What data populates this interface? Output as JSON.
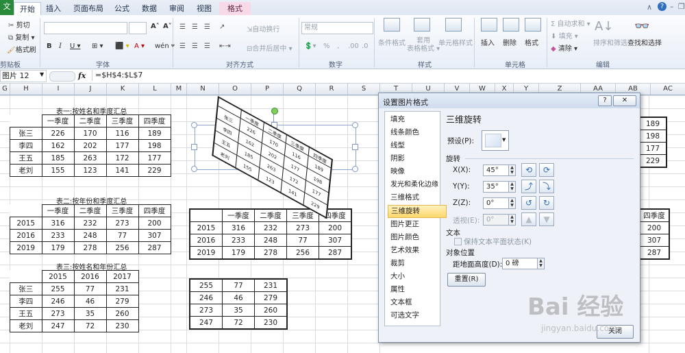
{
  "ribbon": {
    "file_tab": "文件",
    "tabs": [
      "开始",
      "插入",
      "页面布局",
      "公式",
      "数据",
      "审阅",
      "视图",
      "格式"
    ],
    "clipboard": {
      "cut": "剪切",
      "copy": "复制 ▾",
      "format_painter": "格式刷",
      "label": "剪贴板"
    },
    "font": {
      "label": "字体",
      "grow": "A˄",
      "shrink": "A˅",
      "bold": "B",
      "italic": "I",
      "underline": "U ▾",
      "border": "⊞ ▾",
      "fill_color": "⬛ ▾",
      "font_color": "A ▾",
      "wen": "wén ▾"
    },
    "alignment": {
      "wrap": "自动换行",
      "merge": "合并后居中 ▾",
      "label": "对齐方式"
    },
    "number": {
      "format_value": "常规",
      "percent": "%",
      "comma": ",",
      "label": "数字"
    },
    "styles": {
      "conditional": "条件格式",
      "table": "套用\n表格格式 ▾",
      "cell_styles": "单元格样式",
      "label": "样式"
    },
    "cells": {
      "insert": "插入",
      "delete": "删除",
      "format": "格式",
      "label": "单元格"
    },
    "editing": {
      "autosum": "Σ 自动求和 ▾",
      "fill": "填充 ▾",
      "clear": "清除 ▾",
      "sort": "排序和筛选",
      "find": "查找和选择",
      "label": "编辑"
    }
  },
  "formula_bar": {
    "name_box": "图片 12",
    "fx": "fx",
    "formula": "=$H$4:$L$7"
  },
  "columns": [
    "G",
    "H",
    "I",
    "J",
    "K",
    "L",
    "M",
    "N",
    "O",
    "P",
    "Q",
    "R",
    "S",
    "T",
    "U",
    "V",
    "W",
    "X",
    "Y",
    "Z",
    "AA",
    "AB",
    "AC"
  ],
  "table1": {
    "title": "表一:按姓名和季度汇总",
    "header": [
      "",
      "一季度",
      "二季度",
      "三季度",
      "四季度"
    ],
    "rows": [
      [
        "张三",
        "226",
        "170",
        "116",
        "189"
      ],
      [
        "李四",
        "162",
        "202",
        "177",
        "198"
      ],
      [
        "王五",
        "185",
        "263",
        "172",
        "177"
      ],
      [
        "老刘",
        "155",
        "123",
        "141",
        "229"
      ]
    ]
  },
  "table2": {
    "title": "表二:按年份和季度汇总",
    "header": [
      "",
      "一季度",
      "二季度",
      "三季度",
      "四季度"
    ],
    "rows": [
      [
        "2015",
        "316",
        "232",
        "273",
        "200"
      ],
      [
        "2016",
        "233",
        "248",
        "77",
        "307"
      ],
      [
        "2019",
        "179",
        "278",
        "256",
        "287"
      ]
    ]
  },
  "table3": {
    "title": "表三:按姓名和年份汇总",
    "header": [
      "",
      "2015",
      "2016",
      "2017"
    ],
    "rows": [
      [
        "张三",
        "255",
        "77",
        "231"
      ],
      [
        "李四",
        "246",
        "46",
        "279"
      ],
      [
        "王五",
        "273",
        "35",
        "260"
      ],
      [
        "老刘",
        "247",
        "72",
        "230"
      ]
    ]
  },
  "copy2": {
    "header": [
      "",
      "一季度",
      "二季度",
      "三季度",
      "四季度"
    ],
    "rows": [
      [
        "2015",
        "316",
        "232",
        "273",
        "200"
      ],
      [
        "2016",
        "233",
        "248",
        "77",
        "307"
      ],
      [
        "2019",
        "179",
        "278",
        "256",
        "287"
      ]
    ]
  },
  "copy3": {
    "rows": [
      [
        "255",
        "77",
        "231"
      ],
      [
        "246",
        "46",
        "279"
      ],
      [
        "273",
        "35",
        "260"
      ],
      [
        "247",
        "72",
        "230"
      ]
    ]
  },
  "right_partial1": [
    "189",
    "198",
    "177",
    "229"
  ],
  "right_partial2": {
    "header": "四季度",
    "values": [
      "200",
      "307",
      "287"
    ]
  },
  "skewed_picture": {
    "header": [
      "",
      "一季度",
      "二季度",
      "三季度",
      "四季度"
    ],
    "rows": [
      [
        "张三",
        "226",
        "170",
        "116",
        "189"
      ],
      [
        "李四",
        "162",
        "202",
        "177",
        "198"
      ],
      [
        "王五",
        "185",
        "263",
        "172",
        "177"
      ],
      [
        "老刘",
        "155",
        "123",
        "141",
        "229"
      ]
    ]
  },
  "dialog": {
    "title": "设置图片格式",
    "help": "?",
    "nav": [
      "填充",
      "线条颜色",
      "线型",
      "阴影",
      "映像",
      "发光和柔化边缘",
      "三维格式",
      "三维旋转",
      "图片更正",
      "图片颜色",
      "艺术效果",
      "裁剪",
      "大小",
      "属性",
      "文本框",
      "可选文字"
    ],
    "selected_index": 7,
    "section_title": "三维旋转",
    "preset_label": "预设(P):",
    "rotation_label": "旋转",
    "x_label": "X(X):",
    "x_value": "45°",
    "y_label": "Y(Y):",
    "y_value": "35°",
    "z_label": "Z(Z):",
    "z_value": "0°",
    "perspective_label": "透视(E):",
    "perspective_value": "0°",
    "text_label": "文本",
    "keep_flat": "保持文本平面状态(K)",
    "position_label": "对象位置",
    "distance_label": "距地面高度(D):",
    "distance_value": "0 磅",
    "reset": "重置(R)",
    "close": "关闭"
  },
  "watermark": {
    "brand": "Bai 经验",
    "url": "jingyan.baidu.com"
  }
}
